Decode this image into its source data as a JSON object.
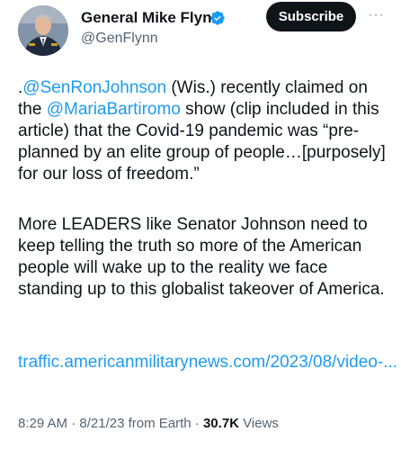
{
  "author": {
    "name": "General Mike Flynn",
    "handle": "@GenFlynn",
    "verified_color": "#1d9bf0"
  },
  "header": {
    "subscribe_label": "Subscribe",
    "more_label": "···"
  },
  "tweet": {
    "p1_prefix": ".",
    "p1_mention1": "@SenRonJohnson",
    "p1_text1": " (Wis.) recently claimed on the ",
    "p1_mention2": "@MariaBartiromo",
    "p1_text2": " show (clip included in this article)   that the Covid-19 pandemic was “pre-planned by an elite group of people…[purposely] for our loss of freedom.”",
    "p2": "More LEADERS like Senator Johnson need to keep telling the truth so more of the American people will wake up to the reality we face standing up to this globalist takeover of America.",
    "link": "traffic.americanmilitarynews.com/2023/08/video-..."
  },
  "meta": {
    "time": "8:29 AM",
    "separator1": " · ",
    "date": "8/21/23",
    "source": " from Earth",
    "separator2": " · ",
    "views_count": "30.7K",
    "views_label": " Views"
  }
}
